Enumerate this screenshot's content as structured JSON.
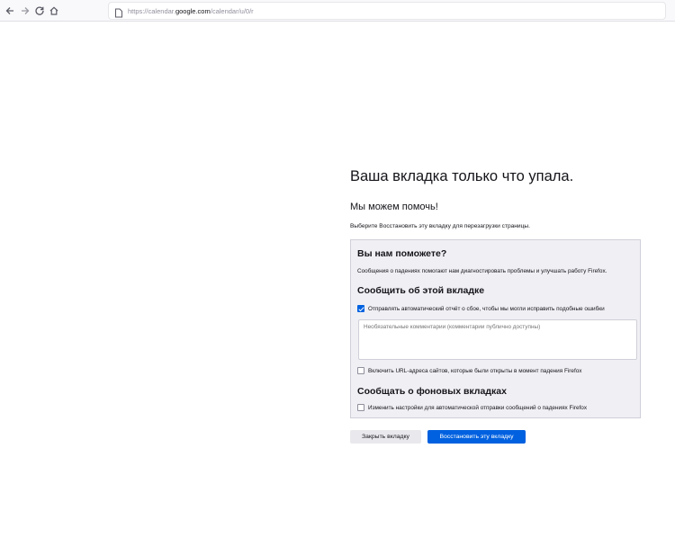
{
  "toolbar": {
    "url_prefix": "https://calendar.",
    "url_host": "google.com",
    "url_path": "/calendar/u/0/r"
  },
  "page": {
    "title": "Ваша вкладка только что упала.",
    "subtitle": "Мы можем помочь!",
    "hint": "Выберите Восстановить эту вкладку для перезагрузки страницы."
  },
  "panel": {
    "title": "Вы нам поможете?",
    "description": "Сообщения о падениях помогают нам диагностировать проблемы и улучшать работу Firefox.",
    "report_title": "Сообщить об этой вкладке",
    "auto_report_label": "Отправлять автоматический отчёт о сбое, чтобы мы могли исправить подобные ошибки",
    "auto_report_checked": true,
    "comment_placeholder": "Необязательные комментарии (комментарии публично доступны)",
    "include_url_label": "Включить URL-адреса сайтов, которые были открыты в момент падения Firefox",
    "include_url_checked": false,
    "background_title": "Сообщать о фоновых вкладках",
    "background_label": "Изменить настройки для автоматической отправки сообщений о падениях Firefox",
    "background_checked": false
  },
  "buttons": {
    "close_tab": "Закрыть вкладку",
    "restore_tab": "Восстановить эту вкладку"
  },
  "colors": {
    "accent": "#0061e0",
    "panel_bg": "#f0f0f4"
  }
}
